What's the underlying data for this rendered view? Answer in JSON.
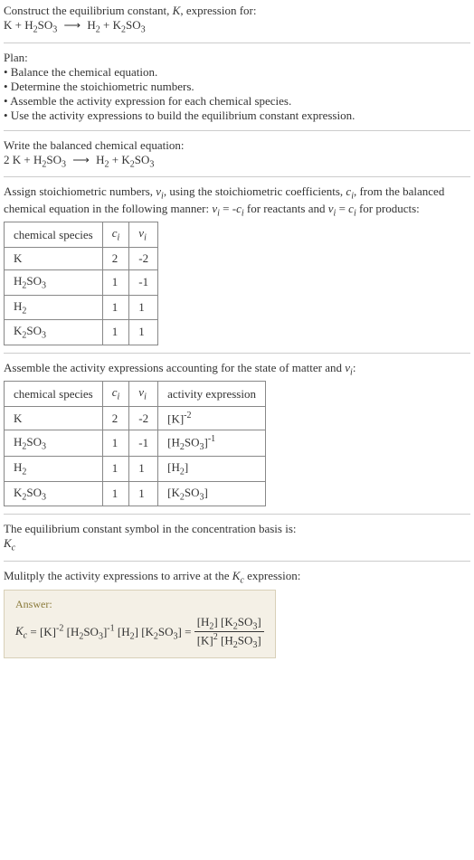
{
  "intro": {
    "line1": "Construct the equilibrium constant, K, expression for:",
    "equation": "K + H₂SO₃ ⟶ H₂ + K₂SO₃"
  },
  "plan": {
    "header": "Plan:",
    "items": [
      "• Balance the chemical equation.",
      "• Determine the stoichiometric numbers.",
      "• Assemble the activity expression for each chemical species.",
      "• Use the activity expressions to build the equilibrium constant expression."
    ]
  },
  "balanced": {
    "header": "Write the balanced chemical equation:",
    "equation": "2 K + H₂SO₃ ⟶ H₂ + K₂SO₃"
  },
  "stoich": {
    "text1": "Assign stoichiometric numbers, νᵢ, using the stoichiometric coefficients, cᵢ, from the balanced chemical equation in the following manner: νᵢ = -cᵢ for reactants and νᵢ = cᵢ for products:",
    "table_headers": [
      "chemical species",
      "cᵢ",
      "νᵢ"
    ],
    "rows": [
      [
        "K",
        "2",
        "-2"
      ],
      [
        "H₂SO₃",
        "1",
        "-1"
      ],
      [
        "H₂",
        "1",
        "1"
      ],
      [
        "K₂SO₃",
        "1",
        "1"
      ]
    ]
  },
  "activity": {
    "header": "Assemble the activity expressions accounting for the state of matter and νᵢ:",
    "table_headers": [
      "chemical species",
      "cᵢ",
      "νᵢ",
      "activity expression"
    ],
    "rows": [
      [
        "K",
        "2",
        "-2",
        "[K]⁻²"
      ],
      [
        "H₂SO₃",
        "1",
        "-1",
        "[H₂SO₃]⁻¹"
      ],
      [
        "H₂",
        "1",
        "1",
        "[H₂]"
      ],
      [
        "K₂SO₃",
        "1",
        "1",
        "[K₂SO₃]"
      ]
    ]
  },
  "kc_symbol": {
    "text": "The equilibrium constant symbol in the concentration basis is:",
    "symbol": "K_c"
  },
  "multiply": {
    "text": "Mulitply the activity expressions to arrive at the K_c expression:"
  },
  "answer": {
    "label": "Answer:",
    "lhs": "K_c = [K]⁻² [H₂SO₃]⁻¹ [H₂] [K₂SO₃] =",
    "num": "[H₂] [K₂SO₃]",
    "den": "[K]² [H₂SO₃]"
  }
}
